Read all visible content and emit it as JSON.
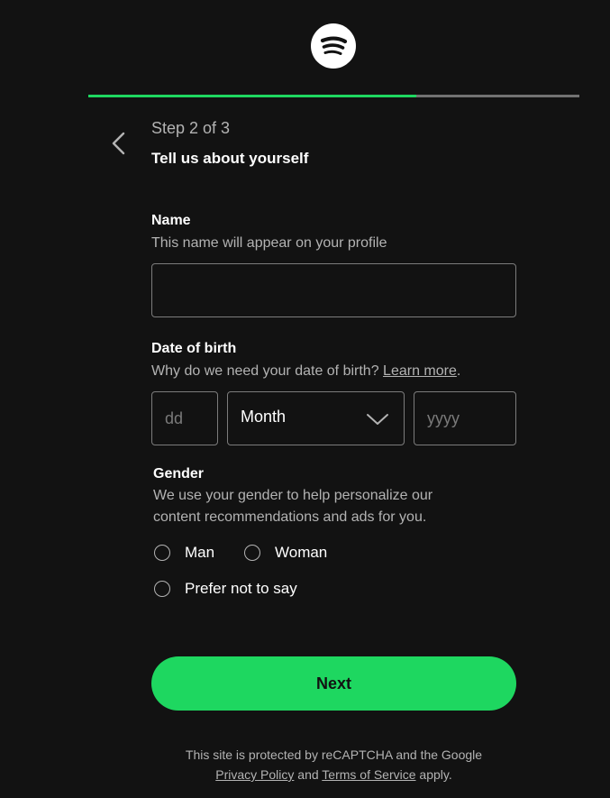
{
  "progress": {
    "fraction": 0.667
  },
  "colors": {
    "accent": "#1ed760",
    "background": "#121212",
    "muted": "#b3b3b3"
  },
  "logo": {
    "icon": "spotify-logo-icon"
  },
  "header": {
    "back_icon": "chevron-left-icon",
    "step_label": "Step 2 of 3",
    "title": "Tell us about yourself"
  },
  "name": {
    "label": "Name",
    "helper": "This name will appear on your profile",
    "value": "",
    "placeholder": ""
  },
  "dob": {
    "label": "Date of birth",
    "helper": "Why do we need your date of birth?",
    "learn_more": "Learn more",
    "helper_suffix": ".",
    "day_placeholder": "dd",
    "month_value": "Month",
    "year_placeholder": "yyyy"
  },
  "gender": {
    "label": "Gender",
    "helper_line1": "We use your gender to help personalize our",
    "helper_line2": "content recommendations and ads for you.",
    "options": [
      "Man",
      "Woman",
      "Prefer not to say"
    ]
  },
  "next_label": "Next",
  "footer": {
    "line1": "This site is protected by reCAPTCHA and the Google",
    "privacy": "Privacy Policy",
    "and": "and",
    "terms": "Terms of Service",
    "apply": "apply."
  }
}
